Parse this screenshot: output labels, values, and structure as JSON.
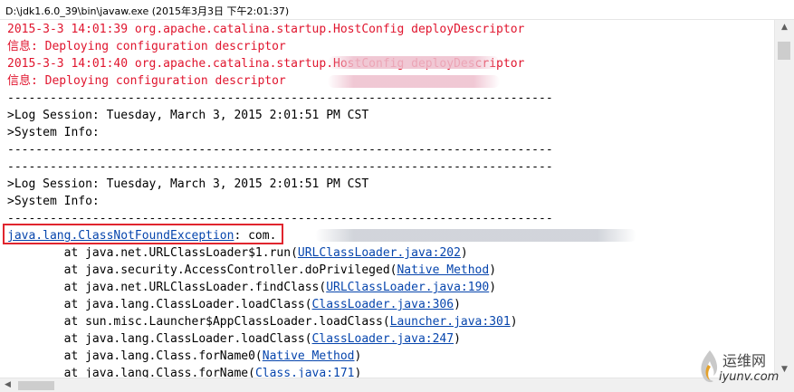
{
  "window": {
    "title": "D:\\jdk1.6.0_39\\bin\\javaw.exe (2015年3月3日 下午2:01:37)"
  },
  "console": {
    "lines": [
      {
        "text": "2015-3-3 14:01:39 org.apache.catalina.startup.HostConfig deployDescriptor",
        "style": "red"
      },
      {
        "text": "信息: Deploying configuration descriptor",
        "style": "red"
      },
      {
        "text": "2015-3-3 14:01:40 org.apache.catalina.startup.HostConfig deployDescriptor",
        "style": "red"
      },
      {
        "text": "信息: Deploying configuration descriptor",
        "style": "red"
      },
      {
        "text": "-----------------------------------------------------------------------------",
        "style": "plain"
      },
      {
        "text": ">Log Session: Tuesday, March 3, 2015 2:01:51 PM CST",
        "style": "plain"
      },
      {
        "text": ">System Info:",
        "style": "plain"
      },
      {
        "text": "-----------------------------------------------------------------------------",
        "style": "plain"
      },
      {
        "text": "-----------------------------------------------------------------------------",
        "style": "plain"
      },
      {
        "text": ">Log Session: Tuesday, March 3, 2015 2:01:51 PM CST",
        "style": "plain"
      },
      {
        "text": ">System Info:",
        "style": "plain"
      },
      {
        "text": "-----------------------------------------------------------------------------",
        "style": "plain"
      }
    ],
    "exception": {
      "link": "java.lang.ClassNotFoundException",
      "suffix": ": com."
    },
    "stack": [
      {
        "prefix": "        at java.net.URLClassLoader$1.run(",
        "link": "URLClassLoader.java:202",
        "suffix": ")"
      },
      {
        "prefix": "        at java.security.AccessController.doPrivileged(",
        "link": "Native Method",
        "suffix": ")"
      },
      {
        "prefix": "        at java.net.URLClassLoader.findClass(",
        "link": "URLClassLoader.java:190",
        "suffix": ")"
      },
      {
        "prefix": "        at java.lang.ClassLoader.loadClass(",
        "link": "ClassLoader.java:306",
        "suffix": ")"
      },
      {
        "prefix": "        at sun.misc.Launcher$AppClassLoader.loadClass(",
        "link": "Launcher.java:301",
        "suffix": ")"
      },
      {
        "prefix": "        at java.lang.ClassLoader.loadClass(",
        "link": "ClassLoader.java:247",
        "suffix": ")"
      },
      {
        "prefix": "        at java.lang.Class.forName0(",
        "link": "Native Method",
        "suffix": ")"
      },
      {
        "prefix": "        at java.lang.Class.forName(",
        "link": "Class.java:171",
        "suffix": ")"
      }
    ]
  },
  "watermark": {
    "top": "运维网",
    "bottom": "iyunv.com"
  },
  "colors": {
    "error_text": "#e0152e",
    "link": "#0645ad",
    "highlight_border": "#e0252e"
  },
  "icons": {
    "scroll_up": "triangle-up-icon",
    "scroll_down": "triangle-down-icon",
    "scroll_left": "triangle-left-icon",
    "watermark_logo": "flame-logo-icon"
  }
}
